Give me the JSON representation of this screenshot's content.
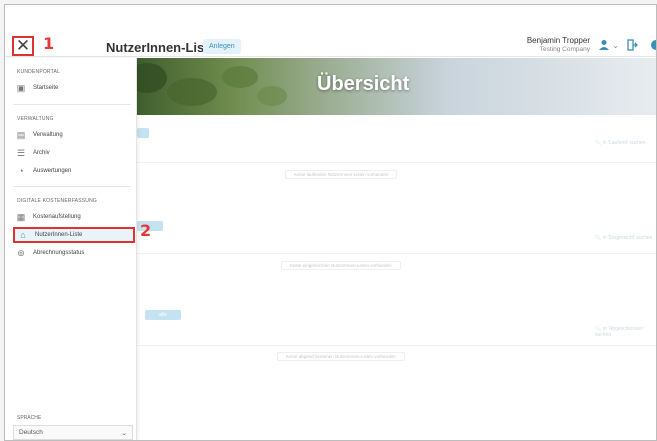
{
  "header": {
    "close_icon": "close-icon",
    "callout_1": "1",
    "title": "NutzerInnen-Liste",
    "anlegen_label": "Anlegen",
    "user_name": "Benjamin Tropper",
    "user_company": "Testing Company"
  },
  "sidebar": {
    "sections": [
      {
        "heading": "KUNDENPORTAL",
        "items": [
          {
            "label": "Startseite",
            "icon": "dashboard-icon"
          }
        ]
      },
      {
        "heading": "VERWALTUNG",
        "items": [
          {
            "label": "Verwaltung",
            "icon": "admin-icon"
          },
          {
            "label": "Archiv",
            "icon": "archive-icon"
          },
          {
            "label": "Auswertungen",
            "icon": "reports-icon"
          }
        ]
      },
      {
        "heading": "DIGITALE KOSTENERFASSUNG",
        "items": [
          {
            "label": "Kostenaufstellung",
            "icon": "cost-list-icon"
          },
          {
            "label": "NutzerInnen-Liste",
            "icon": "users-icon",
            "active": true
          },
          {
            "label": "Abrechnungsstatus",
            "icon": "billing-status-icon"
          }
        ]
      }
    ],
    "callout_2": "2",
    "language_label": "SPRACHE",
    "language_value": "Deutsch"
  },
  "main": {
    "hero_title": "Übersicht",
    "section_3_badge": "alle",
    "empty_messages": [
      "Keine laufenden NutzerInnen-Listen vorhanden",
      "Keine eingereichten NutzerInnen-Listen vorhanden",
      "Keine abgeschlossenen NutzerInnen-Listen vorhanden"
    ],
    "search_placeholders": [
      "in 'Laufend' suchen",
      "in 'Eingereicht' suchen",
      "in 'Abgeschlossen' suchen"
    ]
  },
  "colors": {
    "accent": "#3a8fb7",
    "highlight": "#e53935",
    "active_bg": "#e8f3fa"
  }
}
